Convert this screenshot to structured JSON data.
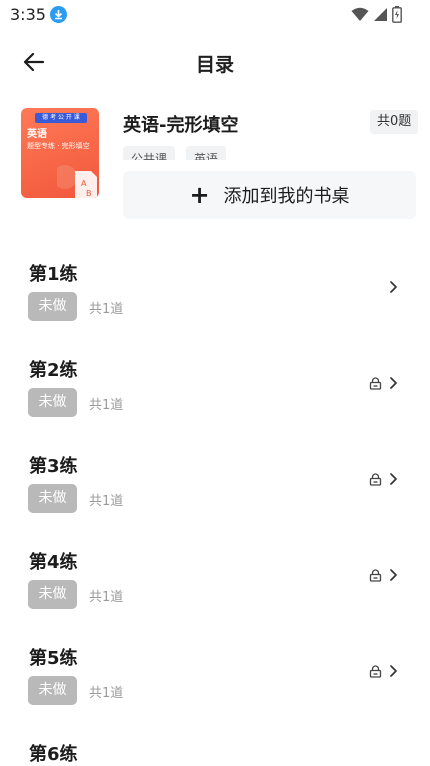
{
  "status_bar": {
    "time": "3:35"
  },
  "header": {
    "title": "目录"
  },
  "book": {
    "title": "英语-完形填空",
    "count_badge": "共0题",
    "tags": [
      "公共课",
      "英语"
    ],
    "add_button_label": "添加到我的书桌",
    "cover": {
      "line1": "英语",
      "line2": "题型专练 · 完形填空"
    }
  },
  "lessons": [
    {
      "title": "第1练",
      "status": "未做",
      "count": "共1道",
      "locked": false
    },
    {
      "title": "第2练",
      "status": "未做",
      "count": "共1道",
      "locked": true
    },
    {
      "title": "第3练",
      "status": "未做",
      "count": "共1道",
      "locked": true
    },
    {
      "title": "第4练",
      "status": "未做",
      "count": "共1道",
      "locked": true
    },
    {
      "title": "第5练",
      "status": "未做",
      "count": "共1道",
      "locked": true
    },
    {
      "title": "第6练",
      "status": "",
      "count": "",
      "locked": false
    }
  ]
}
